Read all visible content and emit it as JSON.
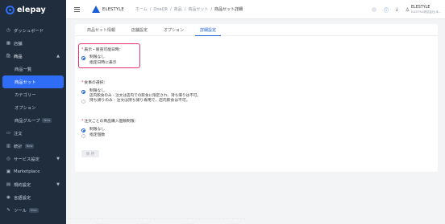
{
  "app": {
    "logo_text": "elepay"
  },
  "sidebar": {
    "items": [
      {
        "icon": "◷",
        "label": "ダッシュボード"
      },
      {
        "icon": "▦",
        "label": "店舗"
      },
      {
        "icon": "🛍",
        "label": "商品"
      },
      {
        "icon": "▭",
        "label": "注文"
      },
      {
        "icon": "▥",
        "label": "統計",
        "badge": "New"
      },
      {
        "icon": "◎",
        "label": "サービス設定"
      },
      {
        "icon": "▣",
        "label": "Marketplace"
      },
      {
        "icon": "▤",
        "label": "規約設定"
      },
      {
        "icon": "◉",
        "label": "言語設定"
      },
      {
        "icon": "✎",
        "label": "ツール",
        "badge": "New"
      }
    ],
    "product_sub": [
      {
        "label": "商品一覧"
      },
      {
        "label": "商品セット"
      },
      {
        "label": "カテゴリー"
      },
      {
        "label": "オプション"
      },
      {
        "label": "商品グループ",
        "badge": "New"
      }
    ]
  },
  "header": {
    "brand": "ELESTYLE",
    "breadcrumbs": [
      "ホーム",
      "OneQR",
      "商品",
      "商品セット"
    ],
    "current": "商品セット詳細",
    "user_name": "ELESTYLE",
    "user_sub": "ELESTYLE株式会社(本..."
  },
  "tabs": [
    "商品セット情報",
    "店舗設定",
    "オプション",
    "詳細設定"
  ],
  "active_tab": "詳細設定",
  "sections": {
    "display": {
      "title": "表示・販売可能日時：",
      "options": [
        {
          "label": "制限なし",
          "checked": true
        },
        {
          "label": "指定日時に表示",
          "checked": false
        }
      ]
    },
    "meal": {
      "title": "食事の選択：",
      "options": [
        {
          "label": "制限なし",
          "desc": "店内飲食のみ - 注文は店内での飲食に限定され、持ち帰りは不可。",
          "checked": true
        },
        {
          "label": "持ち帰りのみ - 注文は持ち帰り専用で、店内飲食は不可。",
          "checked": false
        }
      ]
    },
    "qty": {
      "title": "注文ごとの商品購入個数制限：",
      "options": [
        {
          "label": "制限なし",
          "checked": true
        },
        {
          "label": "指定個数",
          "checked": false
        }
      ]
    }
  },
  "save_label": "保 存",
  "colors": {
    "accent": "#1b5fd8",
    "highlight": "#e8336d",
    "sidebar_bg": "#1f2d3d"
  }
}
